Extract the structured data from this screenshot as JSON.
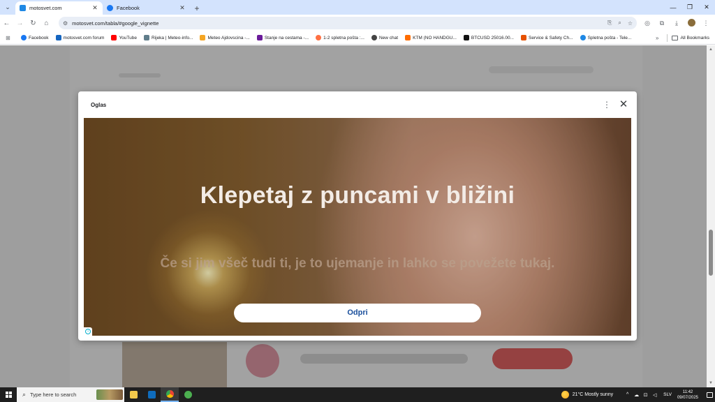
{
  "browser": {
    "tabs": [
      {
        "title": "motosvet.com",
        "active": true,
        "favicon_color": "#1e88e5"
      },
      {
        "title": "Facebook",
        "active": false,
        "favicon_color": "#1877f2"
      }
    ],
    "url": "motosvet.com/tabla/#google_vignette",
    "bookmarks": [
      {
        "label": "Facebook",
        "color": "#1877f2"
      },
      {
        "label": "motosvet.com forum",
        "color": "#1565c0"
      },
      {
        "label": "YouTube",
        "color": "#ff0000"
      },
      {
        "label": "Rijeka | Meteo-info...",
        "color": "#607d8b"
      },
      {
        "label": "Meteo Ajdovscina -...",
        "color": "#f5a623"
      },
      {
        "label": "Stanje na cestama -...",
        "color": "#6a1b9a"
      },
      {
        "label": "1-2 spletna pošta :...",
        "color": "#ff7043"
      },
      {
        "label": "New chat",
        "color": "#444444"
      },
      {
        "label": "KTM (NO HANDGU...",
        "color": "#ff6d00"
      },
      {
        "label": "BTCUSD 25016.00...",
        "color": "#111111"
      },
      {
        "label": "Service & Safety Ch...",
        "color": "#e65100"
      },
      {
        "label": "Spletna pošta - Tele...",
        "color": "#1e88e5"
      }
    ],
    "all_bookmarks": "All Bookmarks"
  },
  "ad": {
    "label": "Oglas",
    "headline": "Klepetaj z puncami v bližini",
    "subtext": "Če si jim všeč tudi ti, je to ujemanje in lahko se povežete tukaj.",
    "cta": "Odpri",
    "adchoices": "i"
  },
  "taskbar": {
    "search_placeholder": "Type here to search",
    "weather": "21°C  Mostly sunny",
    "language": "SLV",
    "time": "11:42",
    "date": "09/07/2025"
  }
}
